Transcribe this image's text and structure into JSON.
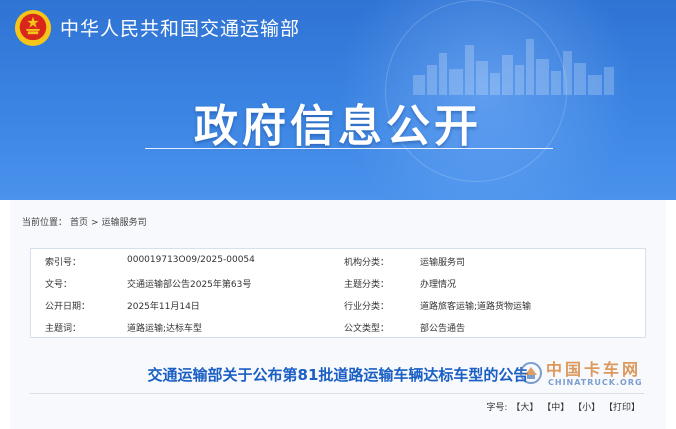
{
  "header": {
    "ministry_name": "中华人民共和国交通运输部",
    "banner_title": "政府信息公开"
  },
  "breadcrumb": {
    "prefix": "当前位置：",
    "home": "首页",
    "separator": ">",
    "current": "运输服务司"
  },
  "metadata": {
    "rows": [
      {
        "label1": "索引号：",
        "value1": "000019713O09/2025-00054",
        "label2": "机构分类：",
        "value2": "运输服务司"
      },
      {
        "label1": "文号：",
        "value1": "交通运输部公告2025年第63号",
        "label2": "主题分类：",
        "value2": "办理情况"
      },
      {
        "label1": "公开日期：",
        "value1": "2025年11月14日",
        "label2": "行业分类：",
        "value2": "道路旅客运输;道路货物运输"
      },
      {
        "label1": "主题词：",
        "value1": "道路运输;达标车型",
        "label2": "公文类型：",
        "value2": "部公告通告"
      }
    ]
  },
  "article": {
    "title": "交通运输部关于公布第81批道路运输车辆达标车型的公告"
  },
  "font_size": {
    "label": "字号:",
    "large": "【大】",
    "medium": "【中】",
    "small": "【小】",
    "print": "【打印】"
  },
  "watermark": {
    "cn": "中国卡车网",
    "en": "CHINATRUCK.ORG"
  },
  "colors": {
    "banner_blue": "#3d86e4",
    "title_blue": "#1a5fc4",
    "emblem_red": "#d8261c",
    "emblem_gold": "#f5c518"
  }
}
